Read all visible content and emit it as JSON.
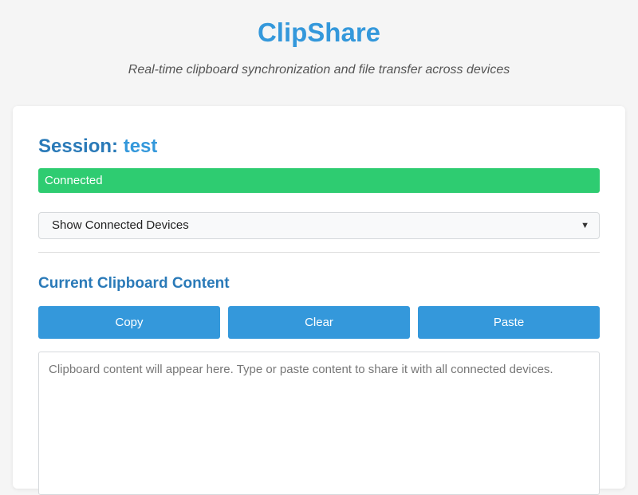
{
  "header": {
    "title": "ClipShare",
    "subtitle": "Real-time clipboard synchronization and file transfer across devices"
  },
  "session": {
    "label": "Session:",
    "name": "test",
    "status": "Connected",
    "status_color": "#2ecc71"
  },
  "devices": {
    "toggle_label": "Show Connected Devices",
    "icon": "chevron-down-icon",
    "glyph": "▼"
  },
  "clipboard": {
    "section_title": "Current Clipboard Content",
    "buttons": {
      "copy": "Copy",
      "clear": "Clear",
      "paste": "Paste"
    },
    "value": "",
    "placeholder": "Clipboard content will appear here. Type or paste content to share it with all connected devices."
  },
  "colors": {
    "accent": "#3498db",
    "heading": "#2a7ab8",
    "success": "#2ecc71",
    "background": "#f5f5f5"
  }
}
